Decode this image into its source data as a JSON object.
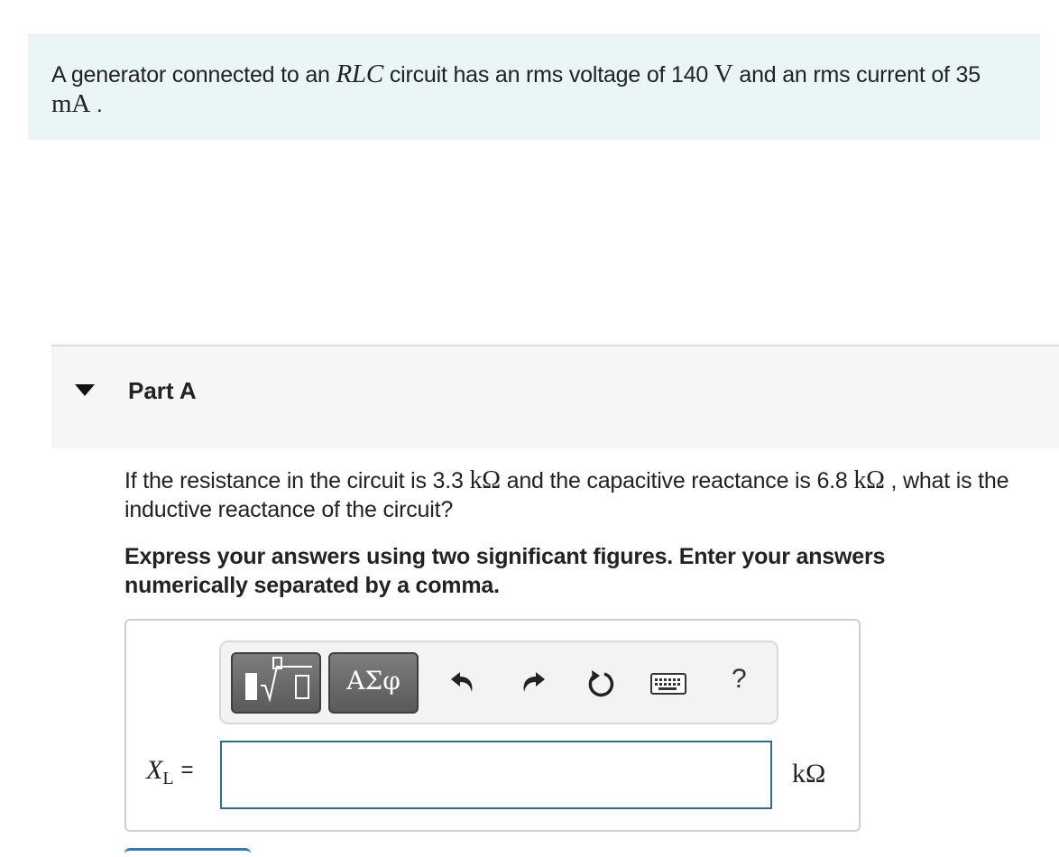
{
  "intro": {
    "text_1": "A generator connected to an ",
    "circuit_type": "RLC",
    "text_2": " circuit has an rms voltage of 140 ",
    "voltage_unit": "V",
    "text_3": " and an rms current of 35 ",
    "current_unit": "mA",
    "text_4": " ."
  },
  "part": {
    "title": "Part A",
    "question": {
      "text_1": "If the resistance in the circuit is 3.3 ",
      "unit_1": "kΩ",
      "text_2": " and the capacitive reactance is 6.8 ",
      "unit_2": "kΩ",
      "text_3": " , what is the inductive reactance of the circuit?"
    },
    "instructions": "Express your answers using two significant figures. Enter your answers numerically separated by a comma."
  },
  "toolbar": {
    "symbols_label": "ΑΣφ",
    "help_label": "?",
    "icons": [
      "templates-icon",
      "undo-icon",
      "redo-icon",
      "reset-icon",
      "keyboard-icon",
      "help-icon"
    ]
  },
  "answer": {
    "variable": "X",
    "subscript": "L",
    "equals": "=",
    "value": "",
    "unit": "kΩ"
  },
  "colors": {
    "intro_background": "#e9f5f7",
    "part_header_background": "#f6f6f6",
    "input_border": "#2e6c99",
    "toolbar_button": "#6b6b6b"
  }
}
